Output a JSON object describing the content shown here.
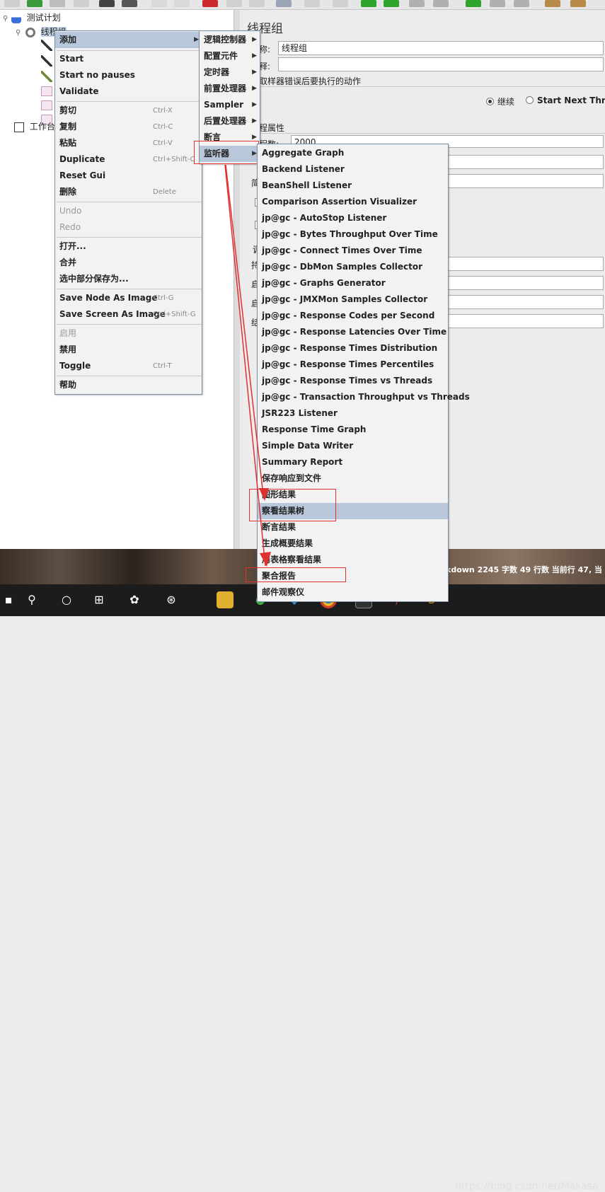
{
  "tree": {
    "items": [
      {
        "label": "测试计划"
      },
      {
        "label": "线程组"
      },
      {
        "label": "工作台"
      }
    ]
  },
  "right": {
    "title": "线程组",
    "name_label": "称:",
    "name_value": "线程组",
    "comment_label": "释:",
    "error_action_label": "取样器错误后要执行的动作",
    "continue_label": "继续",
    "start_next_label": "Start Next Threa",
    "thread_props_label": "程属性",
    "threads_label": "程数:",
    "threads_value": "2000",
    "trunc_1": "简",
    "trunc_2": "调",
    "trunc_3": "持",
    "trunc_4": "启",
    "trunc_5": "启",
    "trunc_6": "结"
  },
  "status": "kdown  2245 字数  49 行数  当前行 47, 当",
  "watermark": "https://blog.csdn.net/Makasa",
  "context_menu": {
    "items": [
      {
        "label": "添加",
        "shortcut": "",
        "arrow": "▶",
        "highlight": true
      },
      {
        "label": "Start",
        "shortcut": ""
      },
      {
        "label": "Start no pauses",
        "shortcut": ""
      },
      {
        "label": "Validate",
        "shortcut": ""
      },
      {
        "label": "剪切",
        "shortcut": "Ctrl-X"
      },
      {
        "label": "复制",
        "shortcut": "Ctrl-C"
      },
      {
        "label": "粘贴",
        "shortcut": "Ctrl-V"
      },
      {
        "label": "Duplicate",
        "shortcut": "Ctrl+Shift-C"
      },
      {
        "label": "Reset Gui",
        "shortcut": ""
      },
      {
        "label": "删除",
        "shortcut": "Delete"
      },
      {
        "label": "Undo",
        "shortcut": "",
        "disabled": true
      },
      {
        "label": "Redo",
        "shortcut": "",
        "disabled": true
      },
      {
        "label": "打开...",
        "shortcut": ""
      },
      {
        "label": "合并",
        "shortcut": ""
      },
      {
        "label": "选中部分保存为...",
        "shortcut": ""
      },
      {
        "label": "Save Node As Image",
        "shortcut": "Ctrl-G"
      },
      {
        "label": "Save Screen As Image",
        "shortcut": "Ctrl+Shift-G"
      },
      {
        "label": "启用",
        "shortcut": "",
        "disabled": true
      },
      {
        "label": "禁用",
        "shortcut": ""
      },
      {
        "label": "Toggle",
        "shortcut": "Ctrl-T"
      },
      {
        "label": "帮助",
        "shortcut": ""
      }
    ]
  },
  "add_menu": {
    "items": [
      {
        "label": "逻辑控制器"
      },
      {
        "label": "配置元件"
      },
      {
        "label": "定时器"
      },
      {
        "label": "前置处理器"
      },
      {
        "label": "Sampler"
      },
      {
        "label": "后置处理器"
      },
      {
        "label": "断言"
      },
      {
        "label": "监听器",
        "highlight": true
      }
    ],
    "arrow": "▶"
  },
  "listener_menu": {
    "items": [
      {
        "label": "Aggregate Graph"
      },
      {
        "label": "Backend Listener"
      },
      {
        "label": "BeanShell Listener"
      },
      {
        "label": "Comparison Assertion Visualizer"
      },
      {
        "label": "jp@gc - AutoStop Listener"
      },
      {
        "label": "jp@gc - Bytes Throughput Over Time"
      },
      {
        "label": "jp@gc - Connect Times Over Time"
      },
      {
        "label": "jp@gc - DbMon Samples Collector"
      },
      {
        "label": "jp@gc - Graphs Generator"
      },
      {
        "label": "jp@gc - JMXMon Samples Collector"
      },
      {
        "label": "jp@gc - Response Codes per Second"
      },
      {
        "label": "jp@gc - Response Latencies Over Time"
      },
      {
        "label": "jp@gc - Response Times Distribution"
      },
      {
        "label": "jp@gc - Response Times Percentiles"
      },
      {
        "label": "jp@gc - Response Times vs Threads"
      },
      {
        "label": "jp@gc - Transaction Throughput vs Threads"
      },
      {
        "label": "JSR223 Listener"
      },
      {
        "label": "Response Time Graph"
      },
      {
        "label": "Simple Data Writer"
      },
      {
        "label": "Summary Report"
      },
      {
        "label": "保存响应到文件"
      },
      {
        "label": "图形结果"
      },
      {
        "label": "察看结果树",
        "highlight": true
      },
      {
        "label": "断言结果"
      },
      {
        "label": "生成概要结果"
      },
      {
        "label": "用表格察看结果"
      },
      {
        "label": "聚合报告"
      },
      {
        "label": "邮件观察仪"
      }
    ]
  }
}
